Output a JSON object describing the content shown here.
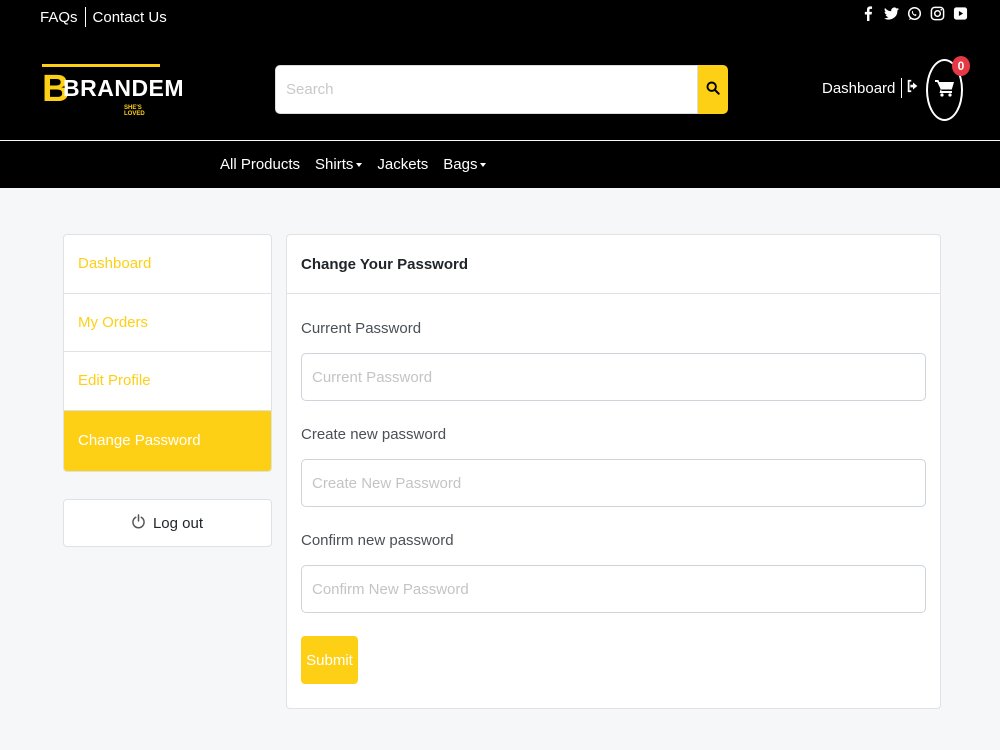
{
  "topbar": {
    "faqs": "FAQs",
    "contact": "Contact Us"
  },
  "social": [
    "facebook-icon",
    "twitter-icon",
    "whatsapp-icon",
    "instagram-icon",
    "youtube-icon"
  ],
  "brand": {
    "letter": "B",
    "name": "BRANDEM",
    "tagline": "SHE'S LOVED"
  },
  "search": {
    "placeholder": "Search"
  },
  "header": {
    "dashboard": "Dashboard",
    "cart_count": "0"
  },
  "nav": {
    "all_products": "All Products",
    "shirts": "Shirts",
    "jackets": "Jackets",
    "bags": "Bags"
  },
  "sidebar": {
    "items": [
      {
        "label": "Dashboard"
      },
      {
        "label": "My Orders"
      },
      {
        "label": "Edit Profile"
      },
      {
        "label": "Change Password"
      }
    ],
    "logout": "Log out"
  },
  "card": {
    "title": "Change Your Password",
    "fields": [
      {
        "label": "Current Password",
        "placeholder": "Current Password"
      },
      {
        "label": "Create new password",
        "placeholder": "Create New Password"
      },
      {
        "label": "Confirm new password",
        "placeholder": "Confirm New Password"
      }
    ],
    "submit": "Submit"
  },
  "colors": {
    "accent": "#fdd016",
    "header_bg": "#000000",
    "badge": "#e63946"
  }
}
